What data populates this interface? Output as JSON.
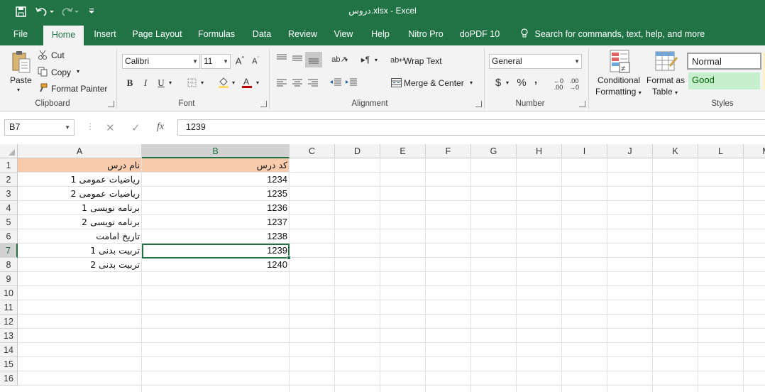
{
  "window": {
    "title": "دروس.xlsx  -  Excel"
  },
  "quick_access": {
    "icons": [
      "save-icon",
      "undo-icon",
      "redo-icon",
      "customize-icon"
    ]
  },
  "tabs": {
    "file": "File",
    "home": "Home",
    "insert": "Insert",
    "page_layout": "Page Layout",
    "formulas": "Formulas",
    "data": "Data",
    "review": "Review",
    "view": "View",
    "help": "Help",
    "nitro": "Nitro Pro",
    "dopdf": "doPDF 10",
    "search": "Search for commands, text, help, and more"
  },
  "clipboard": {
    "paste": "Paste",
    "cut": "Cut",
    "copy": "Copy",
    "format_painter": "Format Painter",
    "label": "Clipboard"
  },
  "font": {
    "name": "Calibri",
    "size": "11",
    "bold": "B",
    "italic": "I",
    "underline": "U",
    "label": "Font",
    "fill_color": "#FFD966",
    "font_color": "#C00000"
  },
  "alignment": {
    "wrap_text": "Wrap Text",
    "merge_center": "Merge & Center",
    "label": "Alignment"
  },
  "number": {
    "format": "General",
    "currency": "$",
    "percent": "%",
    "comma": ",",
    "label": "Number"
  },
  "styles": {
    "conditional_formatting": [
      "Conditional",
      "Formatting"
    ],
    "format_as_table": [
      "Format as",
      "Table"
    ],
    "normal": "Normal",
    "good": "Good",
    "label": "Styles",
    "good_bg": "#C6EFCE",
    "good_fg": "#006100"
  },
  "formula_bar": {
    "name_box": "B7",
    "cancel_icon": "✕",
    "enter_icon": "✓",
    "fx": "fx",
    "value": "1239"
  },
  "sheet": {
    "columns": [
      "A",
      "B",
      "C",
      "D",
      "E",
      "F",
      "G",
      "H",
      "I",
      "J",
      "K",
      "L",
      "M"
    ],
    "rows": [
      "1",
      "2",
      "3",
      "4",
      "5",
      "6",
      "7",
      "8",
      "9",
      "10",
      "11",
      "12",
      "13",
      "14",
      "15",
      "16"
    ],
    "header_fill": "#F8CBAD",
    "selected_cell": "B7",
    "cells": [
      [
        "نام  درس",
        "کد درس"
      ],
      [
        "ریاضیات عمومی 1",
        "1234"
      ],
      [
        "ریاضیات عمومی 2",
        "1235"
      ],
      [
        "برنامه نویسی 1",
        "1236"
      ],
      [
        "برنامه نویسی 2",
        "1237"
      ],
      [
        "تاریخ امامت",
        "1238"
      ],
      [
        "تربیت بدنی 1",
        "1239"
      ],
      [
        "تربیت بدنی 2",
        "1240"
      ]
    ]
  }
}
